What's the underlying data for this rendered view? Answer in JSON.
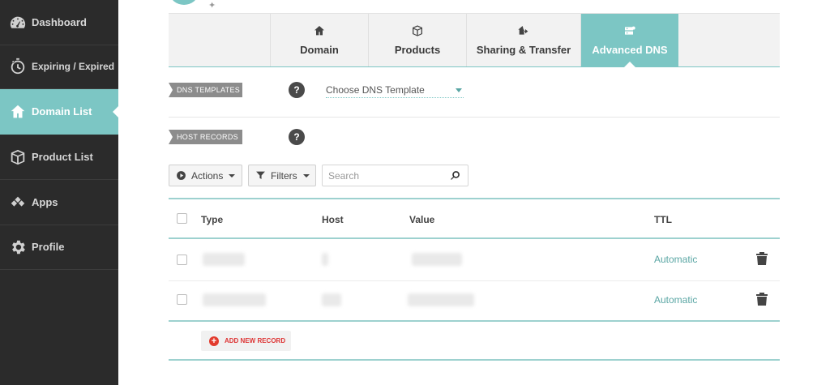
{
  "sidebar": {
    "items": [
      {
        "label": "Dashboard",
        "icon": "speedometer-icon"
      },
      {
        "label": "Expiring / Expired",
        "icon": "stopwatch-icon"
      },
      {
        "label": "Domain List",
        "icon": "home-icon",
        "active": true
      },
      {
        "label": "Product List",
        "icon": "box-icon"
      },
      {
        "label": "Apps",
        "icon": "diamonds-icon"
      },
      {
        "label": "Profile",
        "icon": "gear-icon"
      }
    ]
  },
  "tabs": [
    {
      "label": "Domain",
      "icon": "home-icon"
    },
    {
      "label": "Products",
      "icon": "box-icon"
    },
    {
      "label": "Sharing & Transfer",
      "icon": "share-arrow-icon"
    },
    {
      "label": "Advanced DNS",
      "icon": "server-icon",
      "active": true
    }
  ],
  "dns_templates": {
    "tag": "DNS TEMPLATES",
    "help": "?",
    "select_value": "Choose DNS Template"
  },
  "host_records": {
    "tag": "HOST RECORDS",
    "help": "?"
  },
  "toolbar": {
    "actions_label": "Actions",
    "filters_label": "Filters",
    "search_placeholder": "Search"
  },
  "table": {
    "columns": [
      "Type",
      "Host",
      "Value",
      "TTL"
    ],
    "rows": [
      {
        "ttl": "Automatic"
      },
      {
        "ttl": "Automatic"
      }
    ]
  },
  "add_record_label": "ADD NEW RECORD",
  "colors": {
    "accent": "#7cc6c4",
    "sidebar_bg": "#2b2b2b",
    "add_red": "#e23b2e"
  }
}
